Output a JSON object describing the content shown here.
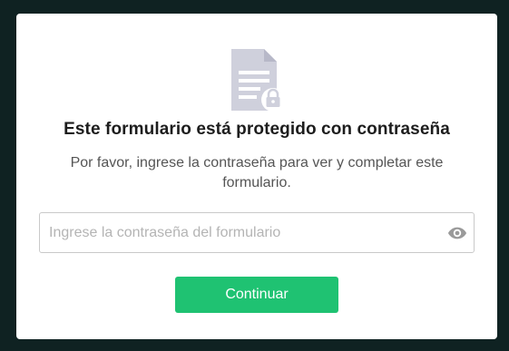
{
  "modal": {
    "icon": "locked-document-icon",
    "title": "Este formulario está protegido con contraseña",
    "subtitle": "Por favor, ingrese la contraseña para ver y completar este formulario.",
    "password": {
      "placeholder": "Ingrese la contraseña del formulario",
      "value": "",
      "toggle_icon": "eye-icon"
    },
    "submit_label": "Continuar"
  },
  "colors": {
    "backdrop": "#0f2222",
    "accent": "#1fc272",
    "icon": "#cfd0dc"
  }
}
